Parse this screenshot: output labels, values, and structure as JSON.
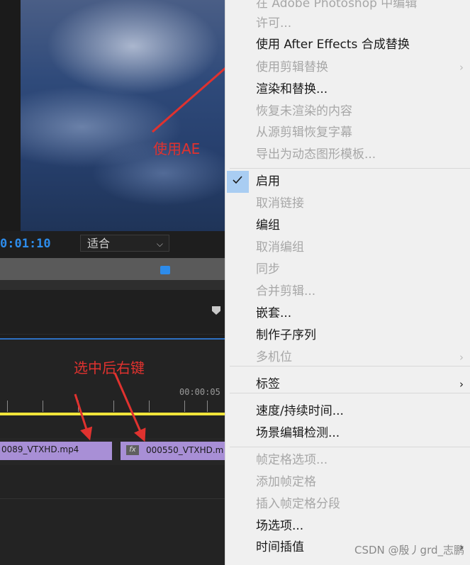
{
  "monitor": {
    "timecode": "0:01:10",
    "fit_value": "适合"
  },
  "timeline": {
    "time_label": "00:00:05",
    "clips": [
      {
        "name": "0089_VTXHD.mp4",
        "fx": false
      },
      {
        "name": "000550_VTXHD.m",
        "fx": true,
        "fx_label": "fx"
      }
    ]
  },
  "annotations": {
    "use_ae": "使用AE",
    "right_click": "选中后右键"
  },
  "menu": {
    "items": [
      {
        "label": "在 Adobe Photoshop 中编辑",
        "disabled": true,
        "submenu": false
      },
      {
        "label": "许可...",
        "disabled": true,
        "submenu": false
      },
      {
        "label": "使用 After Effects 合成替换",
        "disabled": false,
        "submenu": false
      },
      {
        "label": "使用剪辑替换",
        "disabled": true,
        "submenu": true
      },
      {
        "label": "渲染和替换...",
        "disabled": false,
        "submenu": false
      },
      {
        "label": "恢复未渲染的内容",
        "disabled": true,
        "submenu": false
      },
      {
        "label": "从源剪辑恢复字幕",
        "disabled": true,
        "submenu": false
      },
      {
        "label": "导出为动态图形模板...",
        "disabled": true,
        "submenu": false
      },
      {
        "label": "启用",
        "disabled": false,
        "submenu": false,
        "checked": true
      },
      {
        "label": "取消链接",
        "disabled": true,
        "submenu": false
      },
      {
        "label": "编组",
        "disabled": false,
        "submenu": false
      },
      {
        "label": "取消编组",
        "disabled": true,
        "submenu": false
      },
      {
        "label": "同步",
        "disabled": true,
        "submenu": false
      },
      {
        "label": "合并剪辑...",
        "disabled": true,
        "submenu": false
      },
      {
        "label": "嵌套...",
        "disabled": false,
        "submenu": false
      },
      {
        "label": "制作子序列",
        "disabled": false,
        "submenu": false
      },
      {
        "label": "多机位",
        "disabled": true,
        "submenu": true
      },
      {
        "label": "标签",
        "disabled": false,
        "submenu": true
      },
      {
        "label": "速度/持续时间...",
        "disabled": false,
        "submenu": false
      },
      {
        "label": "场景编辑检测...",
        "disabled": false,
        "submenu": false
      },
      {
        "label": "帧定格选项...",
        "disabled": true,
        "submenu": false
      },
      {
        "label": "添加帧定格",
        "disabled": true,
        "submenu": false
      },
      {
        "label": "插入帧定格分段",
        "disabled": true,
        "submenu": false
      },
      {
        "label": "场选项...",
        "disabled": false,
        "submenu": false
      },
      {
        "label": "时间插值",
        "disabled": false,
        "submenu": true
      }
    ],
    "submenu_glyph": "›"
  },
  "watermark": "CSDN @殷丿grd_志鹏",
  "colors": {
    "accent_blue": "#2d8ceb",
    "annotation_red": "#e0322f",
    "clip_purple": "#a88fd6",
    "timeline_yellow": "#f0e43a",
    "check_highlight": "#a9cdf2"
  }
}
